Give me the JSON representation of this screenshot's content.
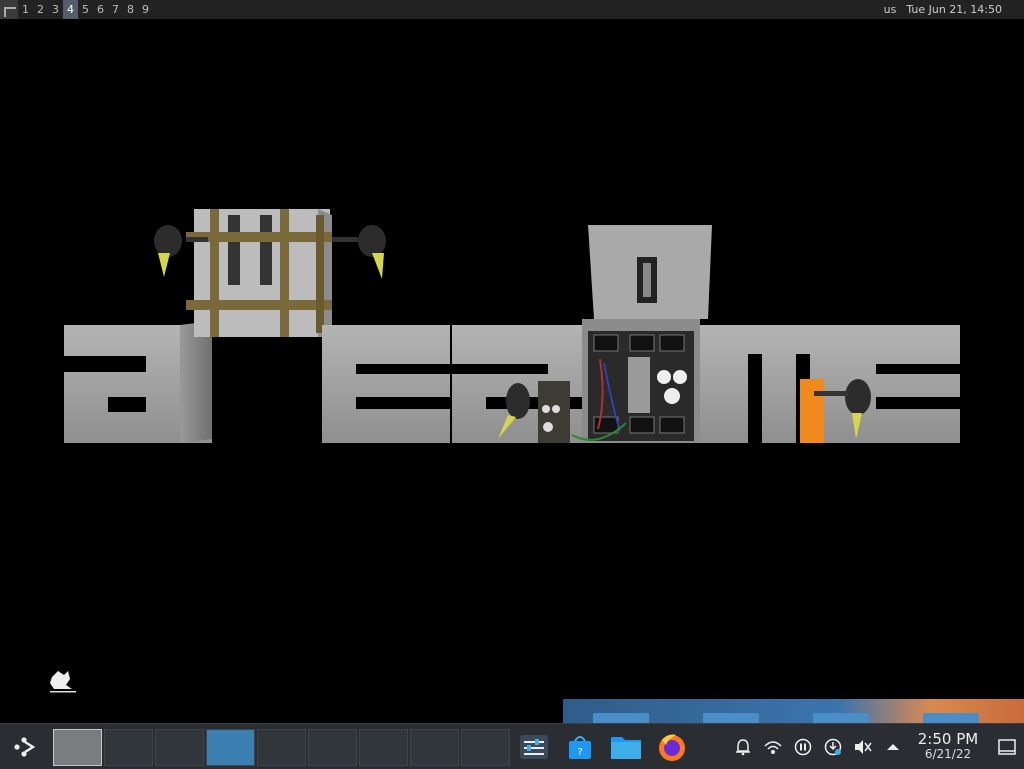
{
  "topbar": {
    "tags": [
      "1",
      "2",
      "3",
      "4",
      "5",
      "6",
      "7",
      "8",
      "9"
    ],
    "active_tag": "4",
    "keyboard_layout": "us",
    "datetime": "Tue Jun 21, 14:50"
  },
  "wallpaper": {
    "subject": "awesome logo made of 3D blocks with a crate and gadgets",
    "background_color": "#000000"
  },
  "panel": {
    "pager_cells": 9,
    "current_desktop": 1,
    "active_window_desktop": 4,
    "tasks": [
      "system-settings-icon",
      "discover-store-icon",
      "file-manager-icon",
      "firefox-icon"
    ],
    "tray": [
      "alarm-icon",
      "network-icon",
      "media-pause-icon",
      "update-icon",
      "volume-muted-icon",
      "tray-expand-icon"
    ],
    "clock_time": "2:50 PM",
    "clock_date": "6/21/22"
  },
  "colors": {
    "topbar_bg": "#222222",
    "active_tag_bg": "#535d6c",
    "panel_bg": "#2a2e32",
    "accent": "#3b7fb0"
  }
}
